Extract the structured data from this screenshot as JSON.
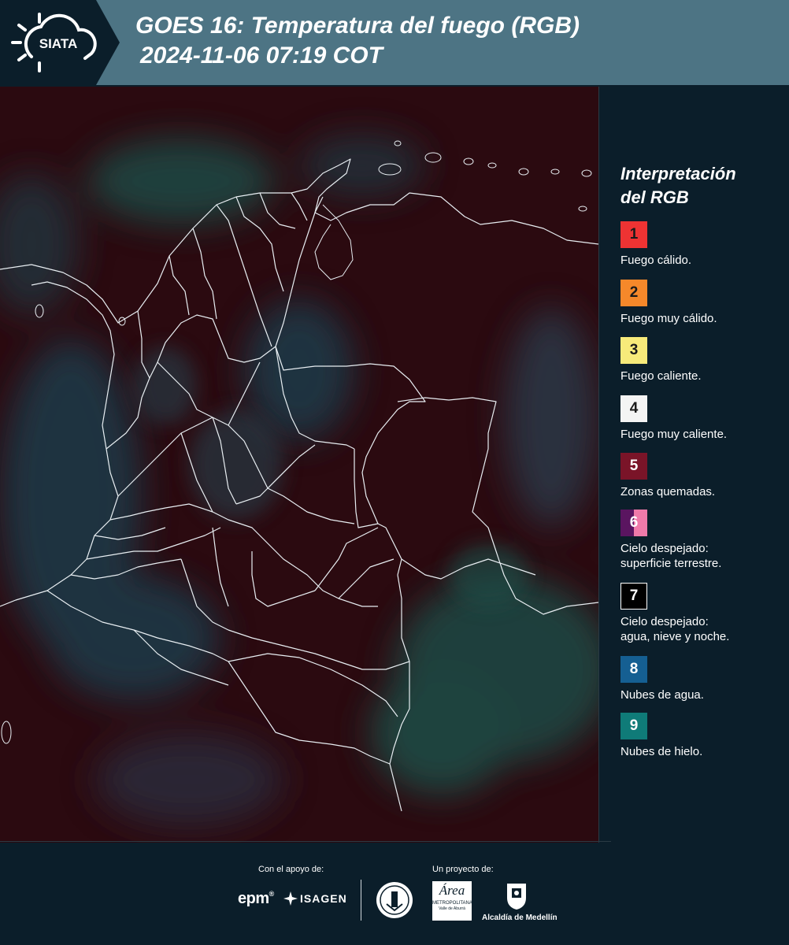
{
  "header": {
    "logo_text": "SIATA",
    "title_line1": "GOES 16: Temperatura del fuego (RGB)",
    "title_line2": "2024-11-06 07:19 COT"
  },
  "legend": {
    "title_line1": "Interpretación",
    "title_line2": "del RGB",
    "items": [
      {
        "num": "1",
        "label_line1": "Fuego cálido.",
        "label_line2": "",
        "color": "#ee3333",
        "text_color": "#1a1a1a"
      },
      {
        "num": "2",
        "label_line1": "Fuego muy cálido.",
        "label_line2": "",
        "color": "#f5882a",
        "text_color": "#1a1a1a"
      },
      {
        "num": "3",
        "label_line1": "Fuego caliente.",
        "label_line2": "",
        "color": "#f7ea7a",
        "text_color": "#1a1a1a"
      },
      {
        "num": "4",
        "label_line1": "Fuego muy caliente.",
        "label_line2": "",
        "color": "#f4f4f4",
        "text_color": "#1a1a1a"
      },
      {
        "num": "5",
        "label_line1": "Zonas quemadas.",
        "label_line2": "",
        "color": "#7a1428",
        "text_color": "#ffffff"
      },
      {
        "num": "6",
        "label_line1": "Cielo despejado:",
        "label_line2": "superficie terrestre.",
        "color": "#5a1560",
        "color2": "#ef7aa9",
        "text_color": "#ffffff"
      },
      {
        "num": "7",
        "label_line1": "Cielo despejado:",
        "label_line2": "agua, nieve y noche.",
        "color": "#000000",
        "text_color": "#ffffff",
        "border": "#ffffff"
      },
      {
        "num": "8",
        "label_line1": "Nubes de agua.",
        "label_line2": "",
        "color": "#155f92",
        "text_color": "#ffffff"
      },
      {
        "num": "9",
        "label_line1": "Nubes de hielo.",
        "label_line2": "",
        "color": "#0f7b78",
        "text_color": "#ffffff"
      }
    ]
  },
  "footer": {
    "support_label": "Con el apoyo de:",
    "project_label": "Un proyecto de:",
    "sponsor1": "epm",
    "sponsor2": "ISAGEN",
    "partner1_line1": "Área",
    "partner1_line2": "METROPOLITANA",
    "partner1_line3": "Valle de Aburrá",
    "partner2": "Alcaldía de Medellín"
  },
  "colors": {
    "header_dark": "#0b1e2a",
    "header_light": "#4d7484",
    "map_base": "#2b0a10",
    "cloud_water": "#1f3a4a",
    "cloud_ice": "#1d4a44",
    "border_line": "#e8eef2"
  }
}
